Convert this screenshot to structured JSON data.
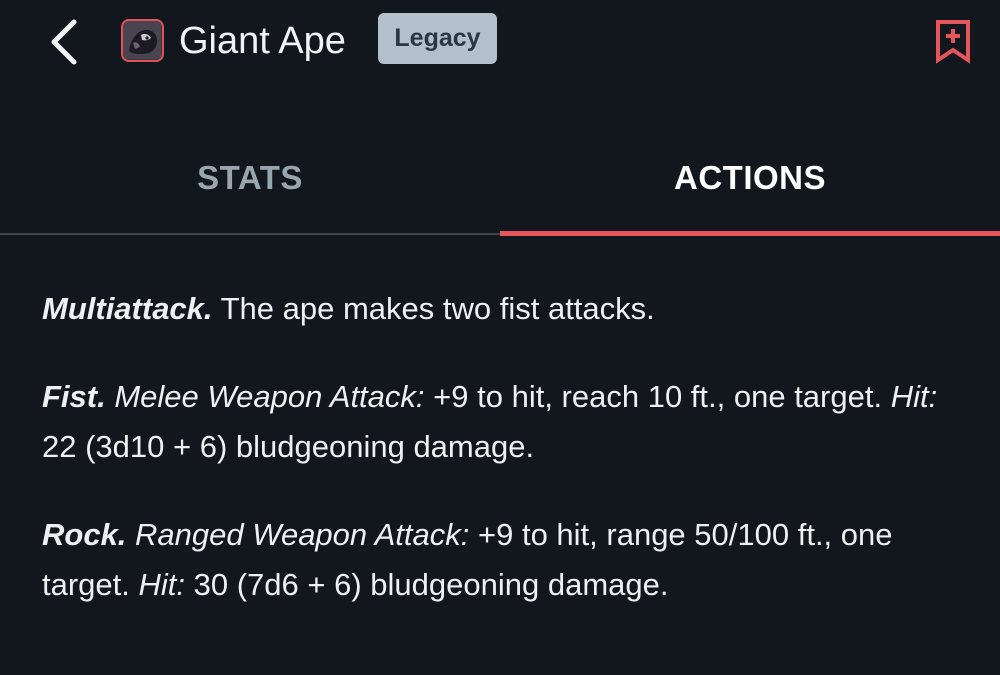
{
  "header": {
    "back_icon": "chevron-left-icon",
    "creature_name": "Giant Ape",
    "badge_label": "Legacy",
    "bookmark_icon": "bookmark-add-icon",
    "accent_color": "#e4565c"
  },
  "tabs": [
    {
      "label": "STATS",
      "active": false
    },
    {
      "label": "ACTIONS",
      "active": true
    }
  ],
  "actions": [
    {
      "name": "Multiattack.",
      "description": "The ape makes two fist attacks."
    },
    {
      "name": "Fist.",
      "attack_type": "Melee Weapon Attack:",
      "attack_text": "+9 to hit, reach 10 ft., one target.",
      "hit_label": "Hit:",
      "hit_text": "22 (3d10 + 6) bludgeoning damage."
    },
    {
      "name": "Rock.",
      "attack_type": "Ranged Weapon Attack:",
      "attack_text": "+9 to hit, range 50/100 ft., one target.",
      "hit_label": "Hit:",
      "hit_text": "30 (7d6 + 6) bludgeoning damage."
    }
  ]
}
